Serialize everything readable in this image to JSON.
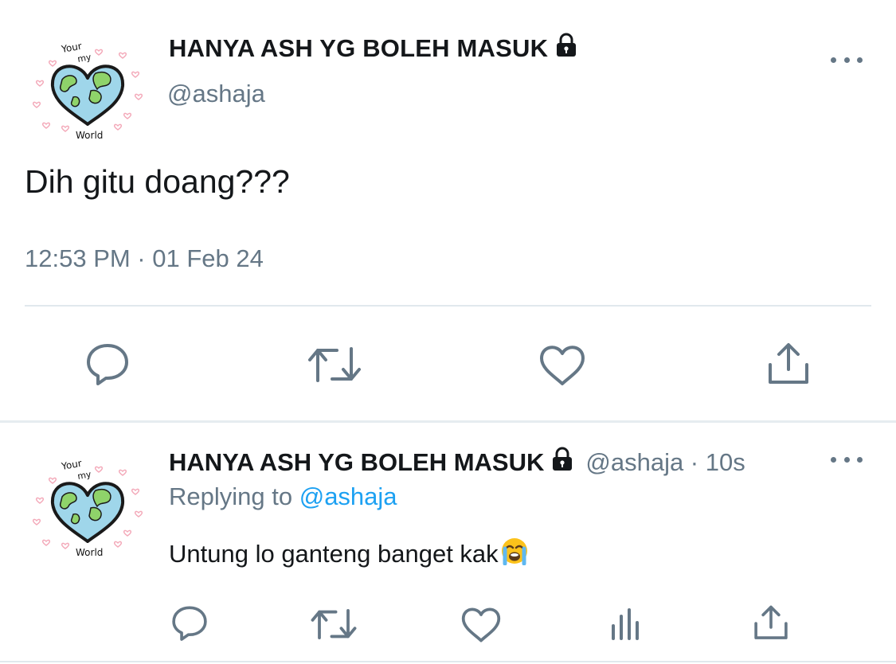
{
  "main_tweet": {
    "display_name": "HANYA ASH YG BOLEH MASUK",
    "handle": "@ashaja",
    "text": "Dih gitu doang???",
    "timestamp": "12:53 PM · 01 Feb 24",
    "avatar_texts": [
      "Your",
      "my",
      "World"
    ],
    "icons": {
      "lock": "lock-icon",
      "more": "more-options-icon",
      "actions": [
        "reply-icon",
        "retweet-icon",
        "like-icon",
        "share-icon"
      ]
    }
  },
  "reply_tweet": {
    "display_name": "HANYA ASH YG BOLEH MASUK",
    "meta": "@ashaja · 10s",
    "replying_label": "Replying to",
    "replying_handle": "@ashaja",
    "text": "Untung lo ganteng banget kak",
    "emoji": "loudly-crying-face",
    "avatar_texts": [
      "Your",
      "my",
      "World"
    ],
    "icons": {
      "lock": "lock-icon",
      "more": "more-options-icon",
      "actions": [
        "reply-icon",
        "retweet-icon",
        "like-icon",
        "analytics-icon",
        "share-icon"
      ]
    }
  },
  "colors": {
    "text": "#14171a",
    "secondary": "#657786",
    "link": "#1da1f2",
    "divider": "#e1e8ed"
  }
}
